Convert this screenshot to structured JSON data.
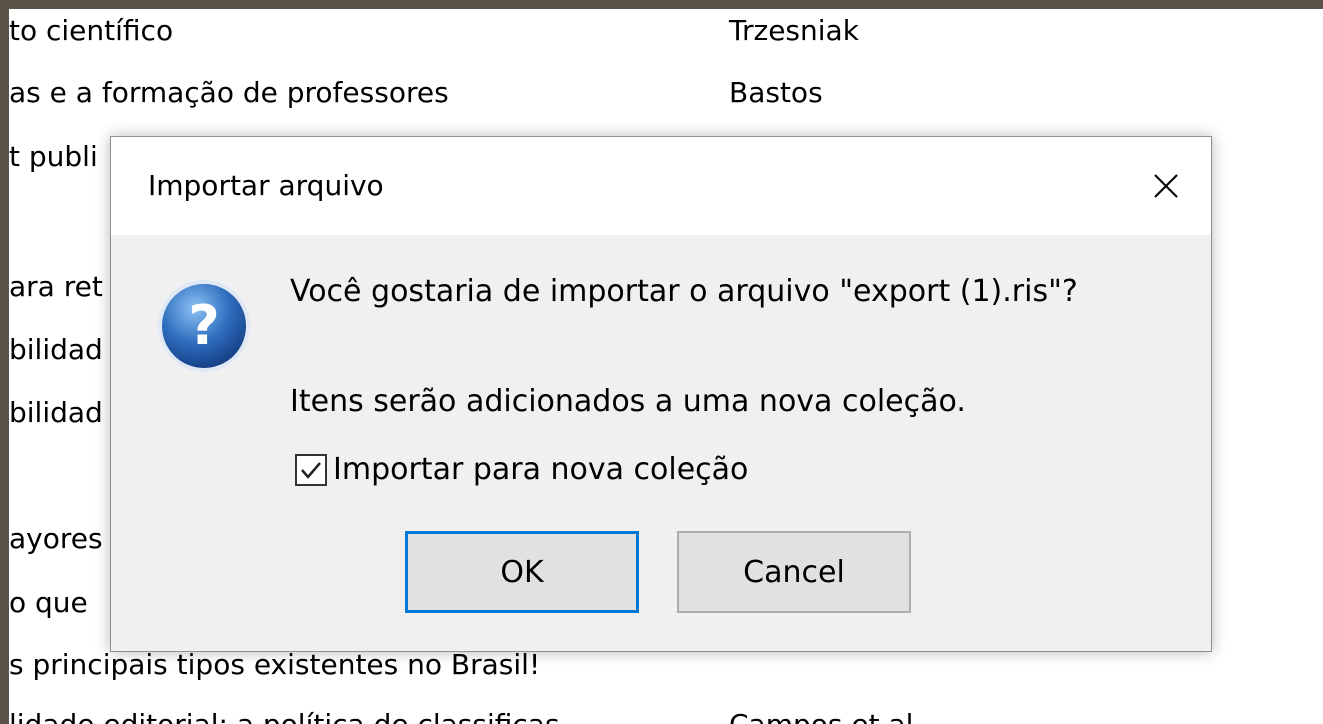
{
  "background_list": {
    "rows": [
      {
        "title": "to científico",
        "author": "Trzesniak"
      },
      {
        "title": "as e a formação de professores",
        "author": "Bastos"
      },
      {
        "title": "t publi",
        "author": ""
      },
      {
        "title": "",
        "author": ""
      },
      {
        "title": "ara ret",
        "author": ""
      },
      {
        "title": "bilidad",
        "author": ""
      },
      {
        "title": "bilidad",
        "author": ""
      },
      {
        "title": "",
        "author": ""
      },
      {
        "title": "ayores",
        "author": ""
      },
      {
        "title": "o que",
        "author": ""
      },
      {
        "title": "s principais tipos existentes no Brasil!",
        "author": ""
      },
      {
        "title": "lidade editorial: a política de classificas",
        "author": "Campos et al"
      }
    ]
  },
  "dialog": {
    "title": "Importar arquivo",
    "message": "Você gostaria de importar o arquivo \"export (1).ris\"?",
    "submessage": "Itens serão adicionados a uma nova coleção.",
    "checkbox_label": "Importar para nova coleção",
    "checkbox_checked": true,
    "ok_label": "OK",
    "cancel_label": "Cancel",
    "close_icon": "close-icon",
    "info_icon": "question-icon"
  },
  "colors": {
    "frame": "#5b5347",
    "dialog_bg": "#f0f0f0",
    "focus_border": "#0078d7",
    "icon_blue": "#2f6fbf"
  }
}
